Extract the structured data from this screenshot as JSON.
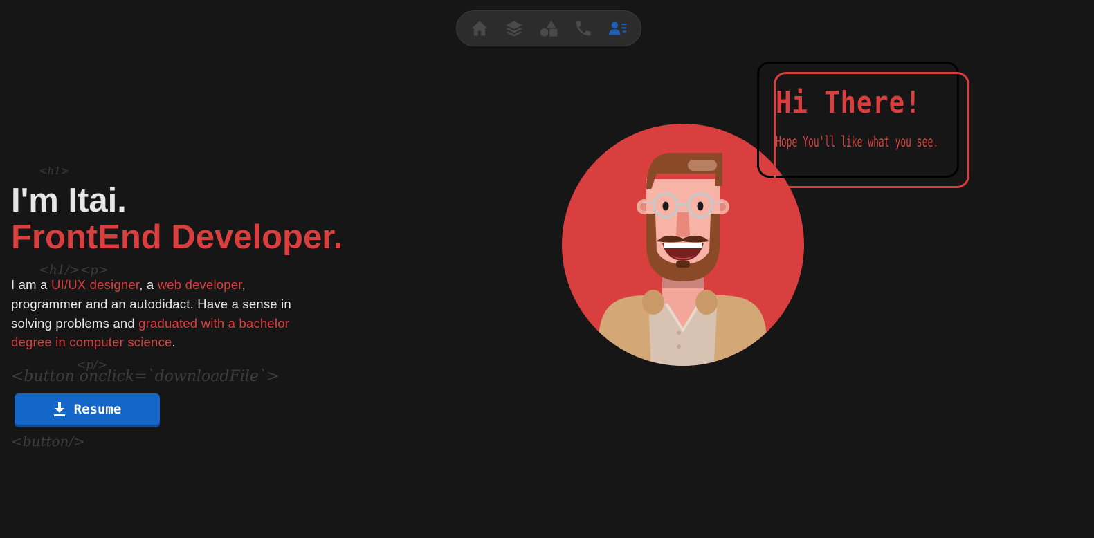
{
  "nav": {
    "items": [
      {
        "icon": "home-icon",
        "active": false
      },
      {
        "icon": "layers-icon",
        "active": false
      },
      {
        "icon": "shapes-icon",
        "active": false
      },
      {
        "icon": "phone-icon",
        "active": false
      },
      {
        "icon": "contact-card-icon",
        "active": true
      }
    ],
    "inactive_color": "#4a4a4a",
    "active_color": "#1d5fb8"
  },
  "code_tags": {
    "h1_open": "<h1>",
    "h1_close_p_open": "<h1/><p>",
    "p_close": "<p/>",
    "button_open": "<button onclick=`downloadFile`>",
    "button_close": "<button/>"
  },
  "hero": {
    "name": "I'm Itai.",
    "role": "FrontEnd Developer.",
    "about": {
      "t1": "I am a ",
      "h1": "UI/UX designer",
      "t2": ", a ",
      "h2": "web developer",
      "t3": ", programmer and an autodidact. Have a sense in solving problems and ",
      "h3": "graduated with a bachelor degree in computer science",
      "t4": "."
    },
    "resume_label": "Resume"
  },
  "speech": {
    "title": "Hi There!",
    "subtitle": "Hope You'll like what you see."
  },
  "colors": {
    "background": "#161616",
    "accent": "#d93f3f",
    "button": "#1466c8",
    "text": "#e8e8e8"
  }
}
